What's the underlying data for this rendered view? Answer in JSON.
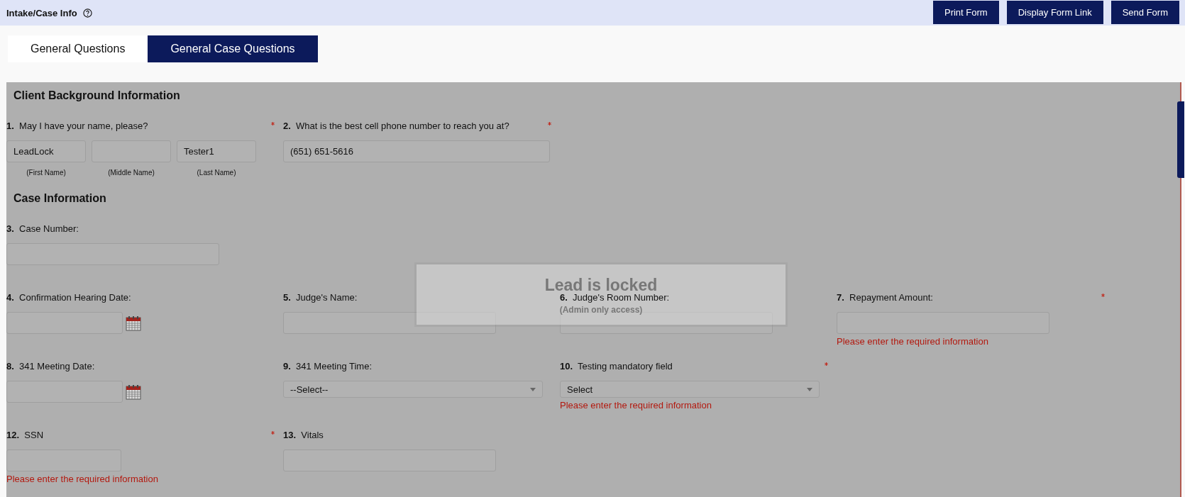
{
  "header": {
    "title": "Intake/Case Info",
    "buttons": [
      "Print Form",
      "Display Form Link",
      "Send Form"
    ]
  },
  "tabs": [
    {
      "label": "General Questions",
      "selected": false
    },
    {
      "label": "General Case Questions",
      "selected": true
    }
  ],
  "sections": [
    {
      "title": "Client Background Information",
      "rows": [
        [
          {
            "number": "1.",
            "label": "May I have your name, please?",
            "required": true,
            "kind": "name",
            "fields": [
              {
                "value": "LeadLock",
                "caption": "(First Name)"
              },
              {
                "caption": "(Middle Name)"
              },
              {
                "value": "Tester1",
                "caption": "(Last Name)"
              }
            ]
          },
          {
            "number": "2.",
            "label": "What is the best cell phone number to reach you at?",
            "required": true,
            "kind": "wide",
            "value": "(651) 651-5616"
          }
        ]
      ]
    },
    {
      "title": "Case Information",
      "rows": [
        [
          {
            "number": "3.",
            "label": "Case Number:",
            "required": false,
            "kind": "text"
          }
        ],
        [
          {
            "number": "4.",
            "label": "Confirmation Hearing Date:",
            "required": false,
            "kind": "date"
          },
          {
            "number": "5.",
            "label": "Judge's Name:",
            "required": false,
            "kind": "text"
          },
          {
            "number": "6.",
            "label": "Judge's Room Number:",
            "required": false,
            "kind": "text"
          },
          {
            "number": "7.",
            "label": "Repayment Amount:",
            "required": true,
            "kind": "text",
            "error": "Please enter the required information"
          }
        ],
        [
          {
            "number": "8.",
            "label": "341 Meeting Date:",
            "required": false,
            "kind": "date"
          },
          {
            "number": "9.",
            "label": "341 Meeting Time:",
            "required": false,
            "kind": "select",
            "value": "--Select--"
          },
          {
            "number": "10.",
            "label": "Testing mandatory field",
            "required": true,
            "kind": "select",
            "value": "Select",
            "error": "Please enter the required information"
          }
        ],
        [
          {
            "number": "12.",
            "label": "SSN",
            "required": true,
            "kind": "short",
            "error": "Please enter the required information"
          },
          {
            "number": "13.",
            "label": "Vitals",
            "required": false,
            "kind": "text"
          }
        ]
      ]
    }
  ],
  "lock": {
    "title": "Lead is locked",
    "subtitle": "(Admin only access)"
  }
}
